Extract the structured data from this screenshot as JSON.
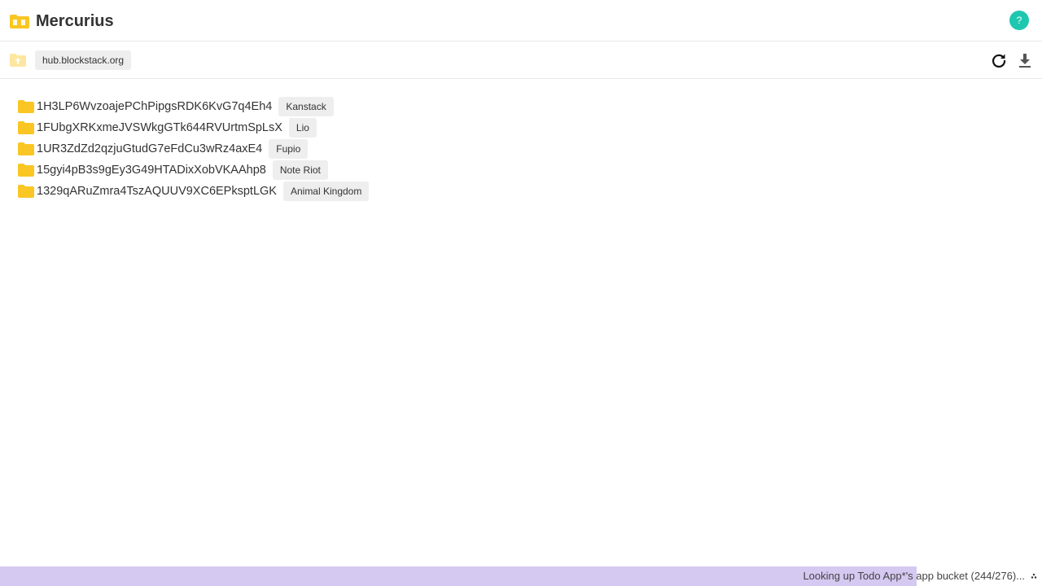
{
  "header": {
    "title": "Mercurius",
    "logo_icon": "folders-icon",
    "help_label": "?",
    "help_color": "#1ec8b0"
  },
  "toolbar": {
    "path": "hub.blockstack.org",
    "up_icon": "folder-up-icon",
    "refresh_icon": "refresh-icon",
    "download_icon": "download-icon"
  },
  "files": [
    {
      "name": "1H3LP6WvzoajePChPipgsRDK6KvG7q4Eh4",
      "app": "Kanstack"
    },
    {
      "name": "1FUbgXRKxmeJVSWkgGTk644RVUrtmSpLsX",
      "app": "Lio"
    },
    {
      "name": "1UR3ZdZd2qzjuGtudG7eFdCu3wRz4axE4",
      "app": "Fupio"
    },
    {
      "name": "15gyi4pB3s9gEy3G49HTADixXobVKAAhp8",
      "app": "Note Riot"
    },
    {
      "name": "1329qARuZmra4TszAQUUV9XC6EPksptLGK",
      "app": "Animal Kingdom"
    }
  ],
  "status": {
    "text": "Looking up Todo App*'s app bucket (244/276)...",
    "progress": 0.88,
    "progress_color": "#d5c8f1"
  },
  "colors": {
    "folder": "#f9c623",
    "folder_light": "#fde7a0",
    "accent": "#1ec8b0"
  }
}
